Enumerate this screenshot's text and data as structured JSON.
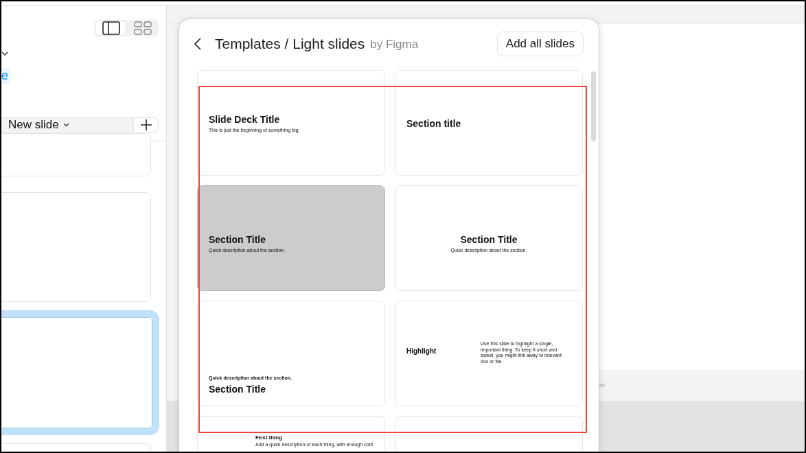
{
  "sidebar": {
    "view_toggle": [
      {
        "kind": "panel",
        "selected": true
      },
      {
        "kind": "grid",
        "selected": false
      }
    ],
    "link_fragment": "e",
    "new_slide": {
      "label": "New slide"
    },
    "thumbnails": [
      {
        "selected": false
      },
      {
        "selected": false
      },
      {
        "selected": true
      },
      {
        "selected": false
      }
    ]
  },
  "templates_panel": {
    "breadcrumb": "Templates / Light slides",
    "author": "by Figma",
    "add_all_button": "Add all slides",
    "slides": [
      {
        "kind": "title",
        "highlighted": false,
        "title": "Slide Deck Title",
        "subtitle": "This is just the beginning of something big."
      },
      {
        "kind": "section-top",
        "highlighted": false,
        "title": "Section title"
      },
      {
        "kind": "section-left",
        "highlighted": true,
        "title": "Section Title",
        "subtitle": "Quick description about the section."
      },
      {
        "kind": "section-center",
        "highlighted": false,
        "title": "Section Title",
        "subtitle": "Quick description about the section."
      },
      {
        "kind": "section-bottom",
        "highlighted": false,
        "title": "Section Title",
        "subtitle": "Quick description about the section."
      },
      {
        "kind": "highlight",
        "highlighted": false,
        "title": "Highlight",
        "subtitle": "Use this slide to highlight a single, important thing. To keep it short and sweet, you might link away to relevant doc or file."
      },
      {
        "kind": "list",
        "highlighted": false,
        "title": "First thing",
        "subtitle": "Add a quick description of each thing, with enough cont"
      },
      {
        "kind": "blank",
        "highlighted": false
      }
    ]
  }
}
